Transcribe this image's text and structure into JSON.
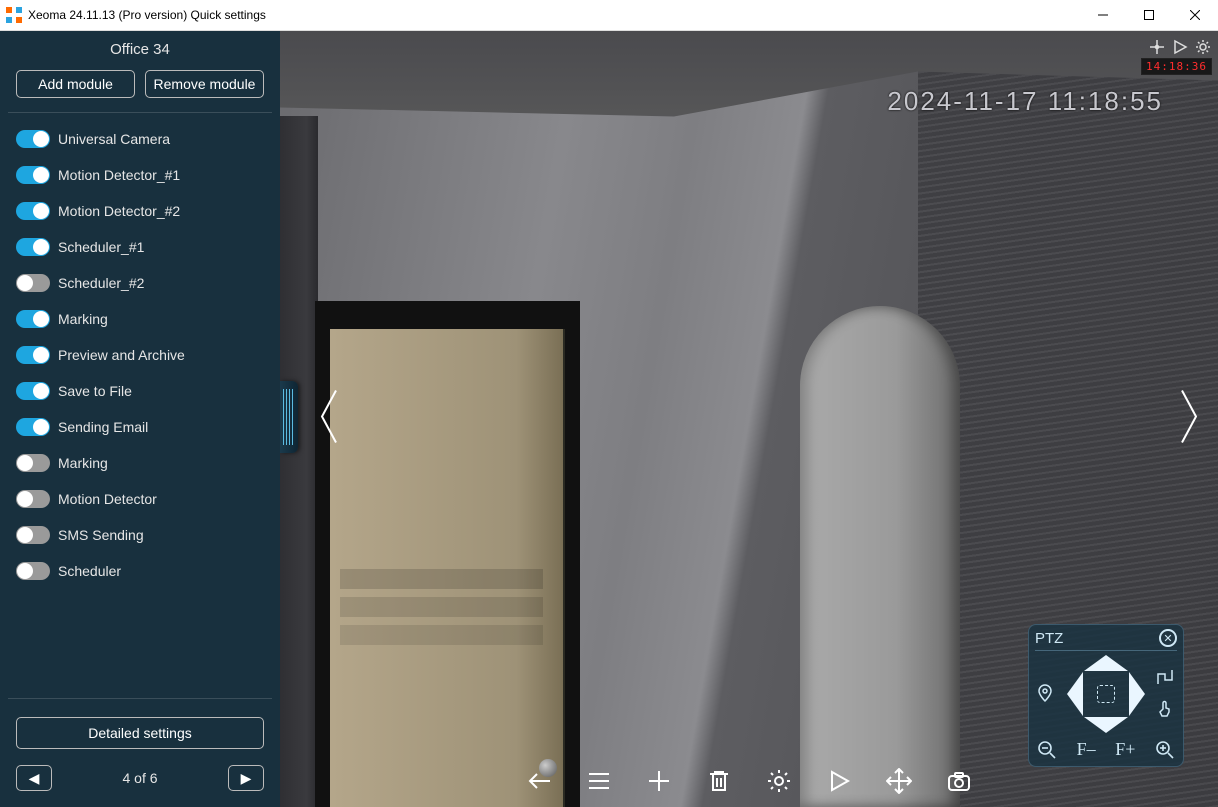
{
  "window": {
    "title": "Xeoma 24.11.13 (Pro version) Quick settings"
  },
  "sidebar": {
    "camera_title": "Office 34",
    "add_module_label": "Add module",
    "remove_module_label": "Remove module",
    "detailed_settings_label": "Detailed settings",
    "pager_text": "4 of 6",
    "modules": [
      {
        "label": "Universal Camera",
        "on": true
      },
      {
        "label": "Motion Detector_#1",
        "on": true
      },
      {
        "label": "Motion Detector_#2",
        "on": true
      },
      {
        "label": "Scheduler_#1",
        "on": true
      },
      {
        "label": "Scheduler_#2",
        "on": false
      },
      {
        "label": "Marking",
        "on": true
      },
      {
        "label": "Preview and Archive",
        "on": true
      },
      {
        "label": "Save to File",
        "on": true
      },
      {
        "label": "Sending Email",
        "on": true
      },
      {
        "label": "Marking",
        "on": false
      },
      {
        "label": "Motion Detector",
        "on": false
      },
      {
        "label": "SMS Sending",
        "on": false
      },
      {
        "label": "Scheduler",
        "on": false
      }
    ]
  },
  "video": {
    "timestamp_overlay": "2024-11-17 11:18:55",
    "corner_time": "14:18:36"
  },
  "ptz": {
    "title": "PTZ",
    "zoom_out": "–",
    "zoom_in": "+",
    "focus_near": "F–",
    "focus_far": "F+"
  }
}
